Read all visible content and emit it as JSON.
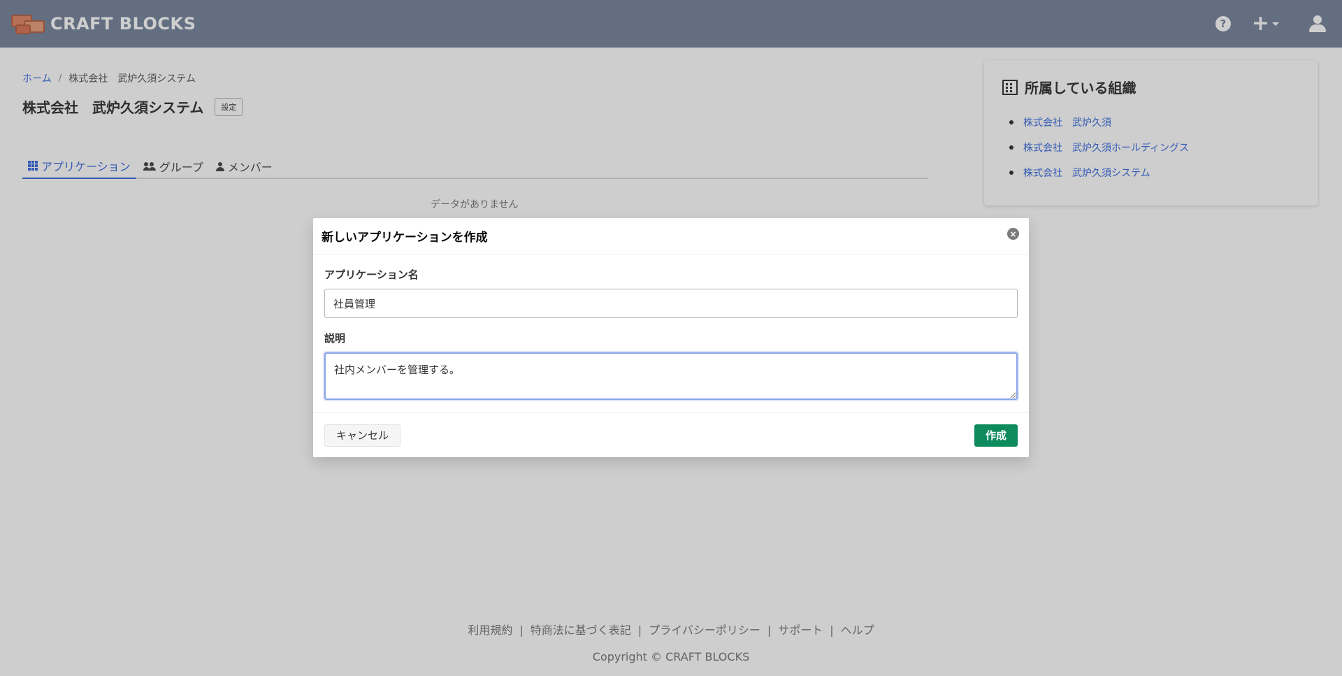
{
  "header": {
    "logo_text": "CRAFT BLOCKS",
    "icons": [
      "help-icon",
      "plus-icon",
      "user-icon"
    ],
    "help_glyph": "?",
    "plus_glyph": "+"
  },
  "breadcrumb": {
    "home": "ホーム",
    "separator": "/",
    "current": "株式会社　武炉久須システム"
  },
  "org": {
    "title": "株式会社　武炉久須システム",
    "settings_label": "設定"
  },
  "tabs": [
    {
      "label": "アプリケーション",
      "icon": "grid-icon",
      "active": true
    },
    {
      "label": "グループ",
      "icon": "people-icon",
      "active": false
    },
    {
      "label": "メンバー",
      "icon": "person-icon",
      "active": false
    }
  ],
  "empty_message": "データがありません",
  "org_card": {
    "title": "所属している組織",
    "icon": "building-icon",
    "items": [
      "株式会社　武炉久須",
      "株式会社　武炉久須ホールディングス",
      "株式会社　武炉久須システム"
    ]
  },
  "footer": {
    "links": [
      "利用規約",
      "特商法に基づく表記",
      "プライバシーポリシー",
      "サポート",
      "ヘルプ"
    ],
    "link_separator": "|",
    "copyright": "Copyright ©   CRAFT BLOCKS"
  },
  "modal": {
    "title": "新しいアプリケーションを作成",
    "close_glyph": "×",
    "name_label": "アプリケーション名",
    "name_value": "社員管理",
    "description_label": "説明",
    "description_value": "社内メンバーを管理する。",
    "cancel_label": "キャンセル",
    "create_label": "作成"
  },
  "colors": {
    "header_bg": "#7a879f",
    "link": "#3e6fe0",
    "primary_button": "#0e8a5f"
  }
}
